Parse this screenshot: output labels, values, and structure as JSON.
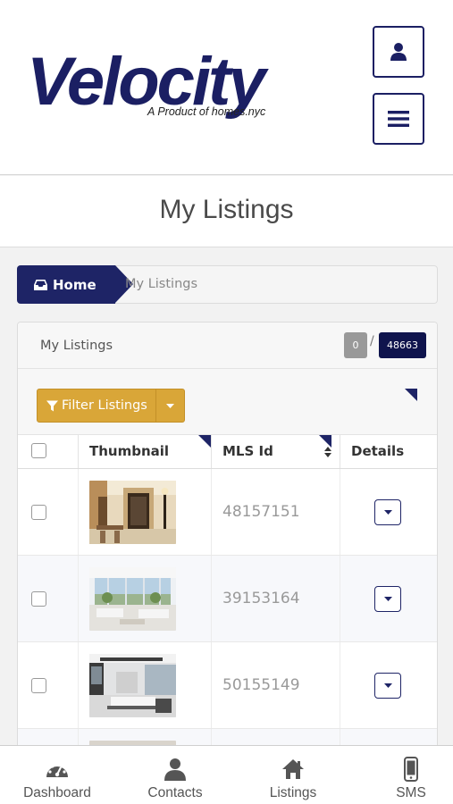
{
  "header": {
    "logo_text": "Velocity",
    "logo_tagline": "A Product of homes.nyc",
    "user_icon": "user-icon",
    "menu_icon": "hamburger-menu-icon",
    "brand_color": "#1b1f63"
  },
  "page": {
    "title": "My Listings"
  },
  "breadcrumb": {
    "home_label": "Home",
    "home_icon": "inbox-home-icon",
    "current": "My Listings"
  },
  "panel": {
    "title": "My Listings",
    "selected_count": "0",
    "separator": "/",
    "total_count": "48663"
  },
  "toolbar": {
    "filter_label": "Filter Listings",
    "filter_icon": "filter-icon",
    "filter_color": "#d9a638"
  },
  "table": {
    "columns": [
      "Thumbnail",
      "MLS Id",
      "Details"
    ],
    "rows": [
      {
        "mls_id": "48157151",
        "thumbnail": "lobby-photo"
      },
      {
        "mls_id": "39153164",
        "thumbnail": "living-room-photo"
      },
      {
        "mls_id": "50155149",
        "thumbnail": "kitchen-photo"
      }
    ]
  },
  "bottom_nav": {
    "items": [
      {
        "label": "Dashboard",
        "icon": "dashboard-gauge-icon"
      },
      {
        "label": "Contacts",
        "icon": "person-icon"
      },
      {
        "label": "Listings",
        "icon": "house-icon"
      },
      {
        "label": "SMS",
        "icon": "mobile-phone-icon"
      }
    ]
  }
}
